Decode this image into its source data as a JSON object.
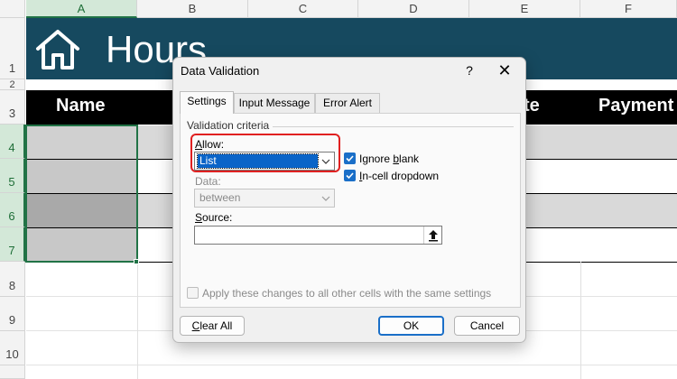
{
  "sheet": {
    "columns": [
      "A",
      "B",
      "C",
      "D",
      "E",
      "F"
    ],
    "rows": [
      "1",
      "2",
      "3",
      "4",
      "5",
      "6",
      "7",
      "8",
      "9",
      "10"
    ],
    "title": "Hours",
    "headers": {
      "name": "Name",
      "col_e_partial": "te",
      "payment": "Payment"
    },
    "colors": {
      "title_band": "#16495f",
      "header_band": "#000000",
      "selection": "#217346"
    },
    "icons": {
      "title": "home-icon"
    }
  },
  "dialog": {
    "title": "Data Validation",
    "help_glyph": "?",
    "close_glyph": "✕",
    "tabs": [
      "Settings",
      "Input Message",
      "Error Alert"
    ],
    "active_tab": "Settings",
    "section_label": "Validation criteria",
    "allow_label_key": "A",
    "allow_label_rest": "llow:",
    "allow_value": "List",
    "ignore_blank_key": "b",
    "ignore_blank_pre": "Ignore ",
    "ignore_blank_post": "lank",
    "ignore_blank_checked": true,
    "in_cell_key": "I",
    "in_cell_rest": "n-cell dropdown",
    "in_cell_checked": true,
    "data_label": "Data:",
    "data_value": "between",
    "source_key": "S",
    "source_rest": "ource:",
    "source_value": "",
    "apply_all_label": "Apply these changes to all other cells with the same settings",
    "apply_all_checked": false,
    "buttons": {
      "clear_all_key": "C",
      "clear_all_rest": "lear All",
      "ok": "OK",
      "cancel": "Cancel"
    },
    "accent_color": "#1a6fc8",
    "highlight_color": "#e02020"
  }
}
